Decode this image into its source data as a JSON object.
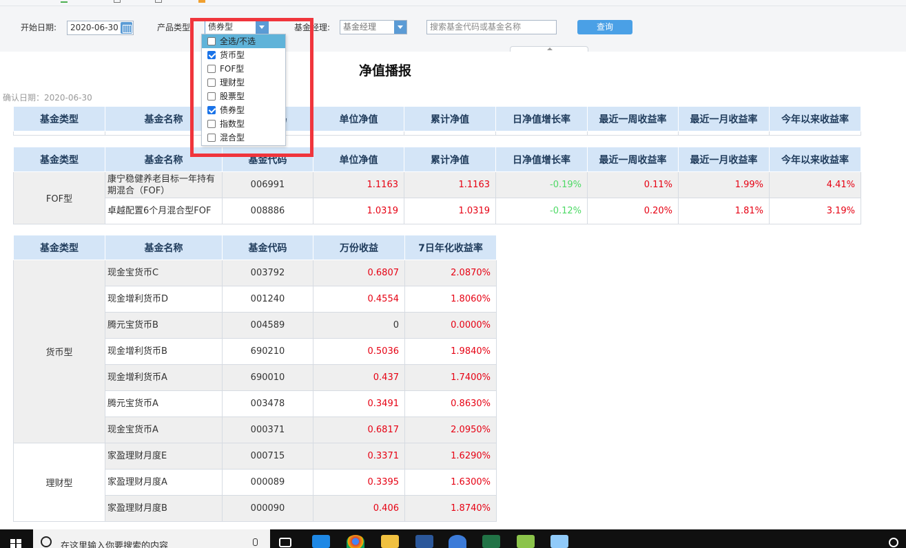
{
  "filters": {
    "start_date_label": "开始日期:",
    "start_date_value": "2020-06-30",
    "product_type_label": "产品类型:",
    "product_type_value": "债券型",
    "manager_label": "基金经理:",
    "manager_placeholder": "基金经理",
    "search_placeholder": "搜索基金代码或基金名称",
    "query_button": "查询"
  },
  "dropdown": {
    "items": [
      {
        "label": "全选/不选",
        "checked": false,
        "highlighted": true
      },
      {
        "label": "货币型",
        "checked": true
      },
      {
        "label": "FOF型",
        "checked": false
      },
      {
        "label": "理财型",
        "checked": false
      },
      {
        "label": "股票型",
        "checked": false
      },
      {
        "label": "债券型",
        "checked": true
      },
      {
        "label": "指数型",
        "checked": false
      },
      {
        "label": "混合型",
        "checked": false
      }
    ]
  },
  "report": {
    "title": "净值播报",
    "confirm_date": "确认日期：2020-06-30"
  },
  "nav_headers": [
    "基金类型",
    "基金名称",
    "基金代码",
    "单位净值",
    "累计净值",
    "日净值增长率",
    "最近一周收益率",
    "最近一月收益率",
    "今年以来收益率"
  ],
  "fof_table": {
    "type": "FOF型",
    "rows": [
      {
        "name": "康宁稳健养老目标一年持有期混合（FOF）",
        "code": "006991",
        "unit_nav": "1.1163",
        "acc_nav": "1.1163",
        "daily": "-0.19%",
        "week": "0.11%",
        "month": "1.99%",
        "ytd": "4.41%"
      },
      {
        "name": "卓越配置6个月混合型FOF",
        "code": "008886",
        "unit_nav": "1.0319",
        "acc_nav": "1.0319",
        "daily": "-0.12%",
        "week": "0.20%",
        "month": "1.81%",
        "ytd": "3.19%"
      }
    ]
  },
  "money_headers": [
    "基金类型",
    "基金名称",
    "基金代码",
    "万份收益",
    "7日年化收益率"
  ],
  "money_table": {
    "groups": [
      {
        "type": "货币型",
        "rows": [
          {
            "name": "现金宝货币C",
            "code": "003792",
            "income": "0.6807",
            "yield7": "2.0870%"
          },
          {
            "name": "现金增利货币D",
            "code": "001240",
            "income": "0.4554",
            "yield7": "1.8060%"
          },
          {
            "name": "腾元宝货币B",
            "code": "004589",
            "income": "0",
            "yield7": "0.0000%"
          },
          {
            "name": "现金增利货币B",
            "code": "690210",
            "income": "0.5036",
            "yield7": "1.9840%"
          },
          {
            "name": "现金增利货币A",
            "code": "690010",
            "income": "0.437",
            "yield7": "1.7400%"
          },
          {
            "name": "腾元宝货币A",
            "code": "003478",
            "income": "0.3491",
            "yield7": "0.8630%"
          },
          {
            "name": "现金宝货币A",
            "code": "000371",
            "income": "0.6817",
            "yield7": "2.0950%"
          }
        ]
      },
      {
        "type": "理财型",
        "rows": [
          {
            "name": "家盈理财月度E",
            "code": "000715",
            "income": "0.3371",
            "yield7": "1.6290%"
          },
          {
            "name": "家盈理财月度A",
            "code": "000089",
            "income": "0.3395",
            "yield7": "1.6300%"
          },
          {
            "name": "家盈理财月度B",
            "code": "000090",
            "income": "0.406",
            "yield7": "1.8740%"
          }
        ]
      }
    ]
  },
  "taskbar": {
    "search_text": "在这里输入你要搜索的内容"
  },
  "colors": {
    "header_bg": "#d4e5f7",
    "positive": "#e60012",
    "negative": "#4cd964",
    "accent": "#4aa0e6",
    "highlight_box": "#f0353c"
  }
}
